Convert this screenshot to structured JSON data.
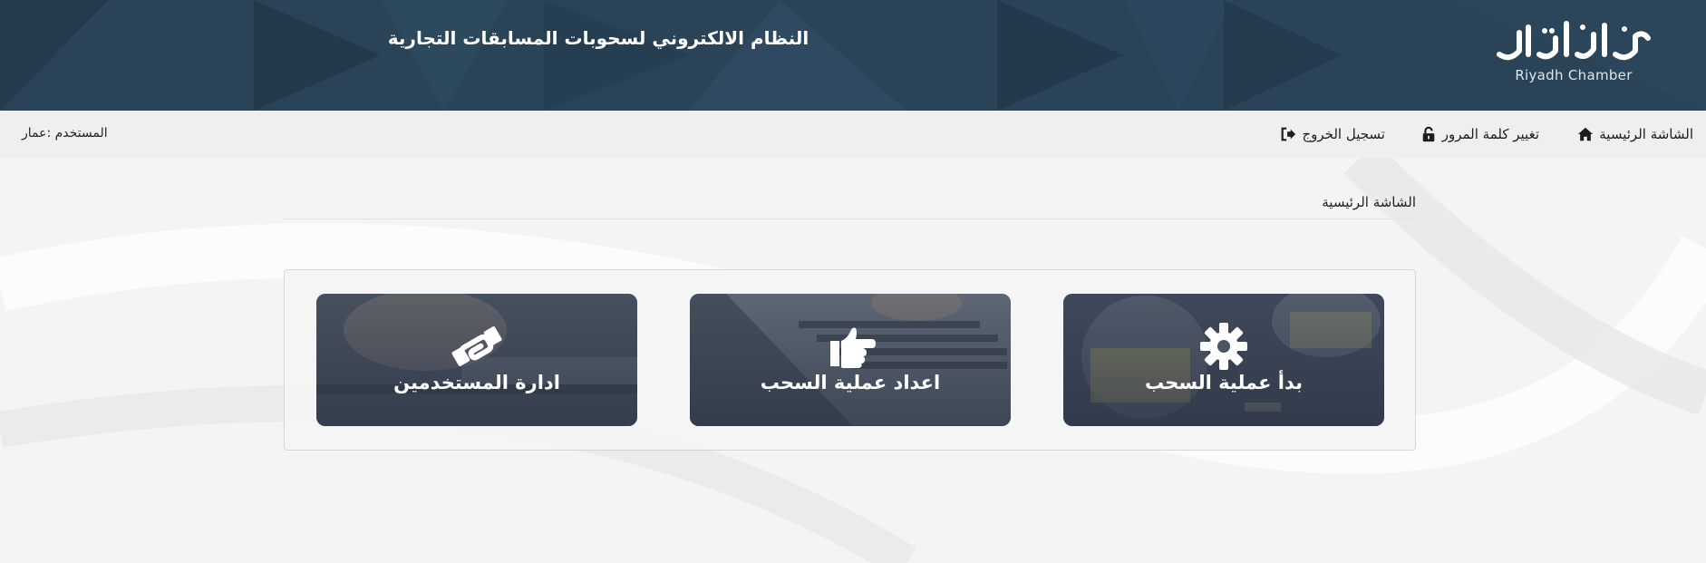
{
  "header": {
    "title": "النظام الالكتروني لسحوبات المسابقات التجارية",
    "logo_text": "Riyadh Chamber",
    "background_color": "#2b4558"
  },
  "nav": {
    "items": [
      {
        "label": "الشاشة الرئيسية",
        "icon": "home-icon"
      },
      {
        "label": "تغيير كلمة المرور",
        "icon": "unlock-icon"
      },
      {
        "label": "تسجيل الخروج",
        "icon": "sign-out-icon"
      }
    ],
    "user_label": "المستخدم :عمار"
  },
  "breadcrumb": "الشاشة الرئيسية",
  "tiles": [
    {
      "label": "بدأ عملية السحب",
      "icon": "gear-icon"
    },
    {
      "label": "اعداد عملية السحب",
      "icon": "hand-pointing-icon"
    },
    {
      "label": "ادارة المستخدمين",
      "icon": "handshake-icon"
    }
  ]
}
